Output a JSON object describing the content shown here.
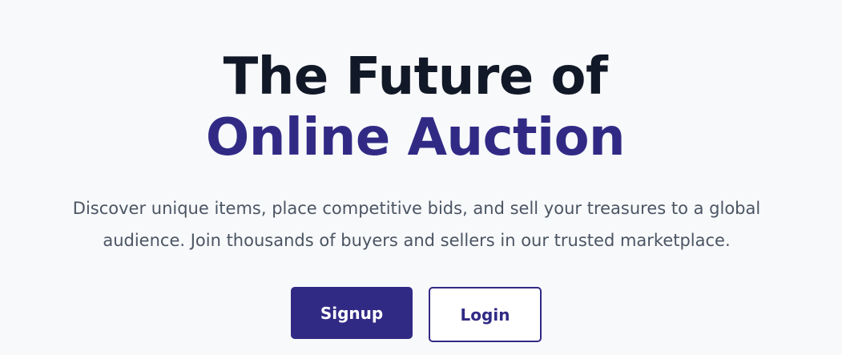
{
  "hero": {
    "title_line_1": "The Future of",
    "title_line_2": "Online Auction",
    "description": "Discover unique items, place competitive bids, and sell your treasures to a global audience. Join thousands of buyers and sellers in our trusted marketplace.",
    "buttons": {
      "signup_label": "Signup",
      "login_label": "Login"
    }
  },
  "colors": {
    "background": "#f8f9fb",
    "title_primary": "#111827",
    "accent": "#312a85",
    "body_text": "#4b5563"
  }
}
